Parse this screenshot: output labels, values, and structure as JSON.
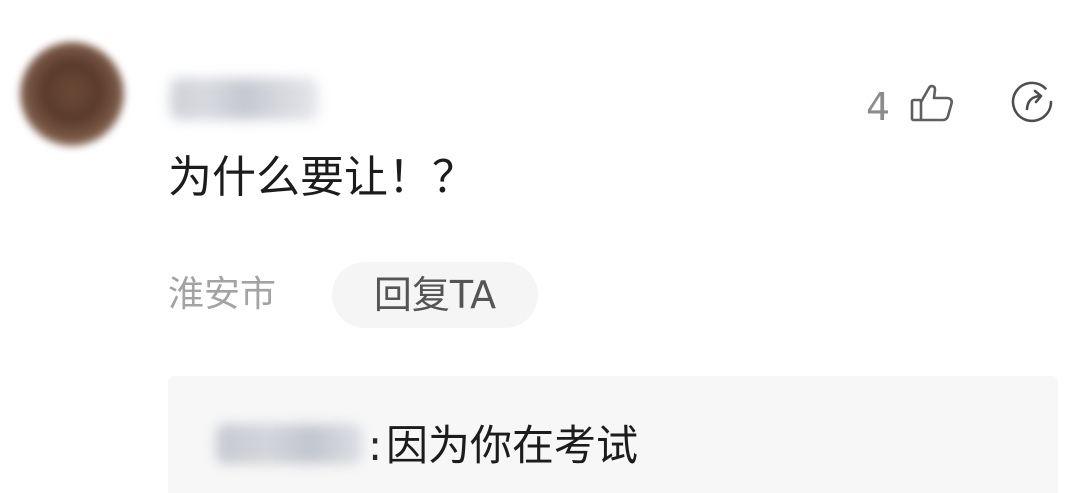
{
  "comment": {
    "text": "为什么要让！？",
    "location": "淮安市",
    "reply_button_label": "回复TA",
    "like_count": "4",
    "like_icon": "thumbs-up-icon",
    "share_icon": "share-icon"
  },
  "reply": {
    "colon": ":",
    "text": "因为你在考试"
  }
}
